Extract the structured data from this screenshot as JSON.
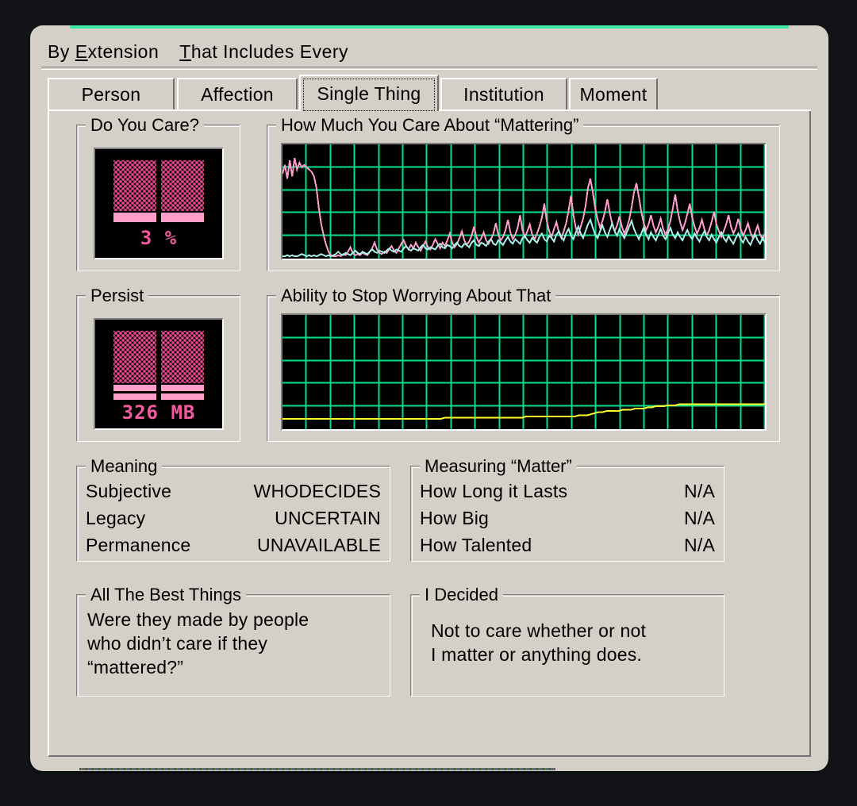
{
  "window": {
    "title": "By Extension",
    "accent_top_color": "#3de8a8",
    "face_color": "#d4d0c8"
  },
  "menubar": {
    "items": [
      {
        "prefix": "By ",
        "accel": "E",
        "suffix": "xtension"
      },
      {
        "prefix": "",
        "accel": "T",
        "suffix": "hat Includes Every"
      }
    ]
  },
  "tabs": {
    "items": [
      {
        "label": "Person",
        "selected": false
      },
      {
        "label": "Affection",
        "selected": false
      },
      {
        "label": "Single Thing",
        "selected": true
      },
      {
        "label": "Institution",
        "selected": false
      },
      {
        "label": "Moment",
        "selected": false
      }
    ]
  },
  "gauges": [
    {
      "title": "Do You Care?",
      "value_label": "3 %",
      "fill_percent": 3,
      "dither_color": "#e8478f",
      "bar_color": "#ff9ecb",
      "text_color": "#f25ba0"
    },
    {
      "title": "Persist",
      "value_label": "326 MB",
      "fill_percent": 62,
      "dither_color": "#e8478f",
      "bar_color": "#ff9ecb",
      "text_color": "#f25ba0"
    }
  ],
  "graphs": [
    {
      "title": "How Much You Care About “Mattering”",
      "grid_color": "#00e08a",
      "background": "#000000"
    },
    {
      "title": "Ability to Stop Worrying About That",
      "grid_color": "#00e08a",
      "background": "#000000"
    }
  ],
  "chart_data": [
    {
      "type": "line",
      "title": "How Much You Care About “Mattering”",
      "xlabel": "",
      "ylabel": "",
      "ylim": [
        0,
        100
      ],
      "grid": true,
      "grid_rows": 5,
      "grid_cols": 20,
      "legend": "none",
      "series": [
        {
          "name": "caring",
          "color": "#ff9ecb",
          "values": [
            74,
            82,
            70,
            86,
            72,
            88,
            78,
            84,
            80,
            82,
            80,
            78,
            76,
            72,
            62,
            44,
            30,
            20,
            12,
            6,
            3,
            2,
            2,
            3,
            2,
            4,
            3,
            6,
            10,
            5,
            3,
            4,
            3,
            5,
            4,
            3,
            6,
            9,
            14,
            8,
            5,
            4,
            6,
            5,
            8,
            11,
            7,
            5,
            9,
            13,
            16,
            11,
            8,
            12,
            9,
            14,
            10,
            7,
            11,
            15,
            10,
            8,
            12,
            17,
            13,
            9,
            14,
            11,
            16,
            22,
            14,
            10,
            13,
            18,
            24,
            16,
            12,
            15,
            20,
            28,
            19,
            14,
            18,
            23,
            16,
            13,
            17,
            22,
            31,
            21,
            16,
            19,
            25,
            34,
            23,
            17,
            21,
            27,
            38,
            25,
            19,
            24,
            30,
            21,
            17,
            22,
            28,
            36,
            48,
            33,
            24,
            19,
            26,
            32,
            23,
            18,
            24,
            31,
            42,
            55,
            38,
            27,
            21,
            28,
            35,
            46,
            62,
            70,
            58,
            44,
            34,
            27,
            33,
            41,
            52,
            40,
            30,
            24,
            29,
            37,
            28,
            22,
            27,
            34,
            45,
            58,
            66,
            54,
            41,
            31,
            25,
            30,
            38,
            29,
            23,
            28,
            35,
            26,
            21,
            26,
            33,
            44,
            56,
            42,
            32,
            25,
            31,
            39,
            48,
            36,
            28,
            22,
            27,
            34,
            26,
            20,
            25,
            32,
            41,
            30,
            24,
            19,
            24,
            30,
            38,
            28,
            22,
            27,
            35,
            26,
            20,
            25,
            31,
            23,
            18,
            23,
            29,
            21,
            17,
            22
          ]
        },
        {
          "name": "worrying",
          "color": "#a8f0e8",
          "values": [
            2,
            2,
            3,
            2,
            3,
            2,
            2,
            3,
            4,
            3,
            2,
            3,
            2,
            3,
            2,
            3,
            4,
            3,
            2,
            3,
            2,
            3,
            4,
            6,
            4,
            3,
            5,
            4,
            3,
            5,
            7,
            5,
            4,
            6,
            5,
            4,
            6,
            8,
            6,
            5,
            7,
            6,
            5,
            7,
            9,
            7,
            6,
            8,
            7,
            6,
            9,
            11,
            8,
            7,
            9,
            8,
            7,
            10,
            12,
            9,
            8,
            10,
            9,
            8,
            11,
            13,
            10,
            9,
            12,
            11,
            9,
            12,
            14,
            11,
            10,
            13,
            12,
            10,
            14,
            16,
            12,
            11,
            14,
            13,
            11,
            15,
            17,
            13,
            12,
            16,
            14,
            12,
            16,
            19,
            15,
            13,
            17,
            15,
            13,
            18,
            20,
            16,
            14,
            18,
            16,
            14,
            19,
            22,
            17,
            15,
            20,
            18,
            15,
            21,
            24,
            19,
            16,
            22,
            26,
            20,
            17,
            23,
            28,
            22,
            18,
            24,
            30,
            34,
            27,
            21,
            18,
            24,
            29,
            23,
            19,
            25,
            31,
            24,
            20,
            26,
            22,
            18,
            23,
            28,
            33,
            26,
            21,
            17,
            22,
            27,
            21,
            17,
            23,
            19,
            16,
            21,
            26,
            20,
            17,
            22,
            27,
            21,
            18,
            23,
            19,
            16,
            21,
            25,
            20,
            17,
            22,
            18,
            15,
            20,
            24,
            19,
            16,
            21,
            17,
            14,
            19,
            23,
            18,
            15,
            20,
            16,
            13,
            18,
            22,
            17,
            14,
            19,
            15,
            12,
            17,
            21,
            16,
            13,
            18,
            14
          ]
        }
      ]
    },
    {
      "type": "line",
      "title": "Ability to Stop Worrying About That",
      "xlabel": "",
      "ylabel": "",
      "ylim": [
        0,
        100
      ],
      "grid": true,
      "grid_rows": 5,
      "grid_cols": 20,
      "legend": "none",
      "series": [
        {
          "name": "ability",
          "color": "#ffff2e",
          "values": [
            9,
            9,
            9,
            9,
            9,
            9,
            9,
            9,
            9,
            9,
            9,
            9,
            9,
            9,
            9,
            9,
            9,
            9,
            9,
            9,
            9,
            9,
            9,
            9,
            9,
            9,
            9,
            9,
            9,
            9,
            9,
            9,
            9,
            9,
            9,
            9,
            9,
            9,
            9,
            9,
            10,
            10,
            10,
            10,
            10,
            10,
            10,
            10,
            10,
            10,
            10,
            10,
            10,
            10,
            10,
            10,
            10,
            10,
            10,
            10,
            11,
            11,
            11,
            11,
            11,
            11,
            11,
            11,
            11,
            11,
            11,
            11,
            11,
            12,
            12,
            12,
            13,
            14,
            15,
            15,
            16,
            16,
            16,
            16,
            17,
            17,
            17,
            18,
            18,
            18,
            19,
            19,
            20,
            20,
            20,
            21,
            21,
            21,
            22,
            22,
            22,
            22,
            22,
            22,
            22,
            22,
            22,
            22,
            22,
            22,
            22,
            22,
            22,
            22,
            22,
            22,
            22,
            22,
            22,
            22
          ]
        }
      ]
    }
  ],
  "info_panels": [
    {
      "title": "Meaning",
      "rows": [
        {
          "key": "Subjective",
          "value": "WHODECIDES"
        },
        {
          "key": "Legacy",
          "value": "UNCERTAIN"
        },
        {
          "key": "Permanence",
          "value": "UNAVAILABLE"
        }
      ]
    },
    {
      "title": "Measuring “Matter”",
      "rows": [
        {
          "key": "How Long it Lasts",
          "value": "N/A"
        },
        {
          "key": "How Big",
          "value": "N/A"
        },
        {
          "key": "How Talented",
          "value": "N/A"
        }
      ]
    }
  ],
  "prose_panels": [
    {
      "title": "All The Best Things",
      "lines": [
        "Were they made by people",
        "who didn’t care if they",
        "“mattered?”"
      ]
    },
    {
      "title": "I Decided",
      "lines": [
        "Not to care whether or not",
        "I matter or anything does."
      ]
    }
  ]
}
